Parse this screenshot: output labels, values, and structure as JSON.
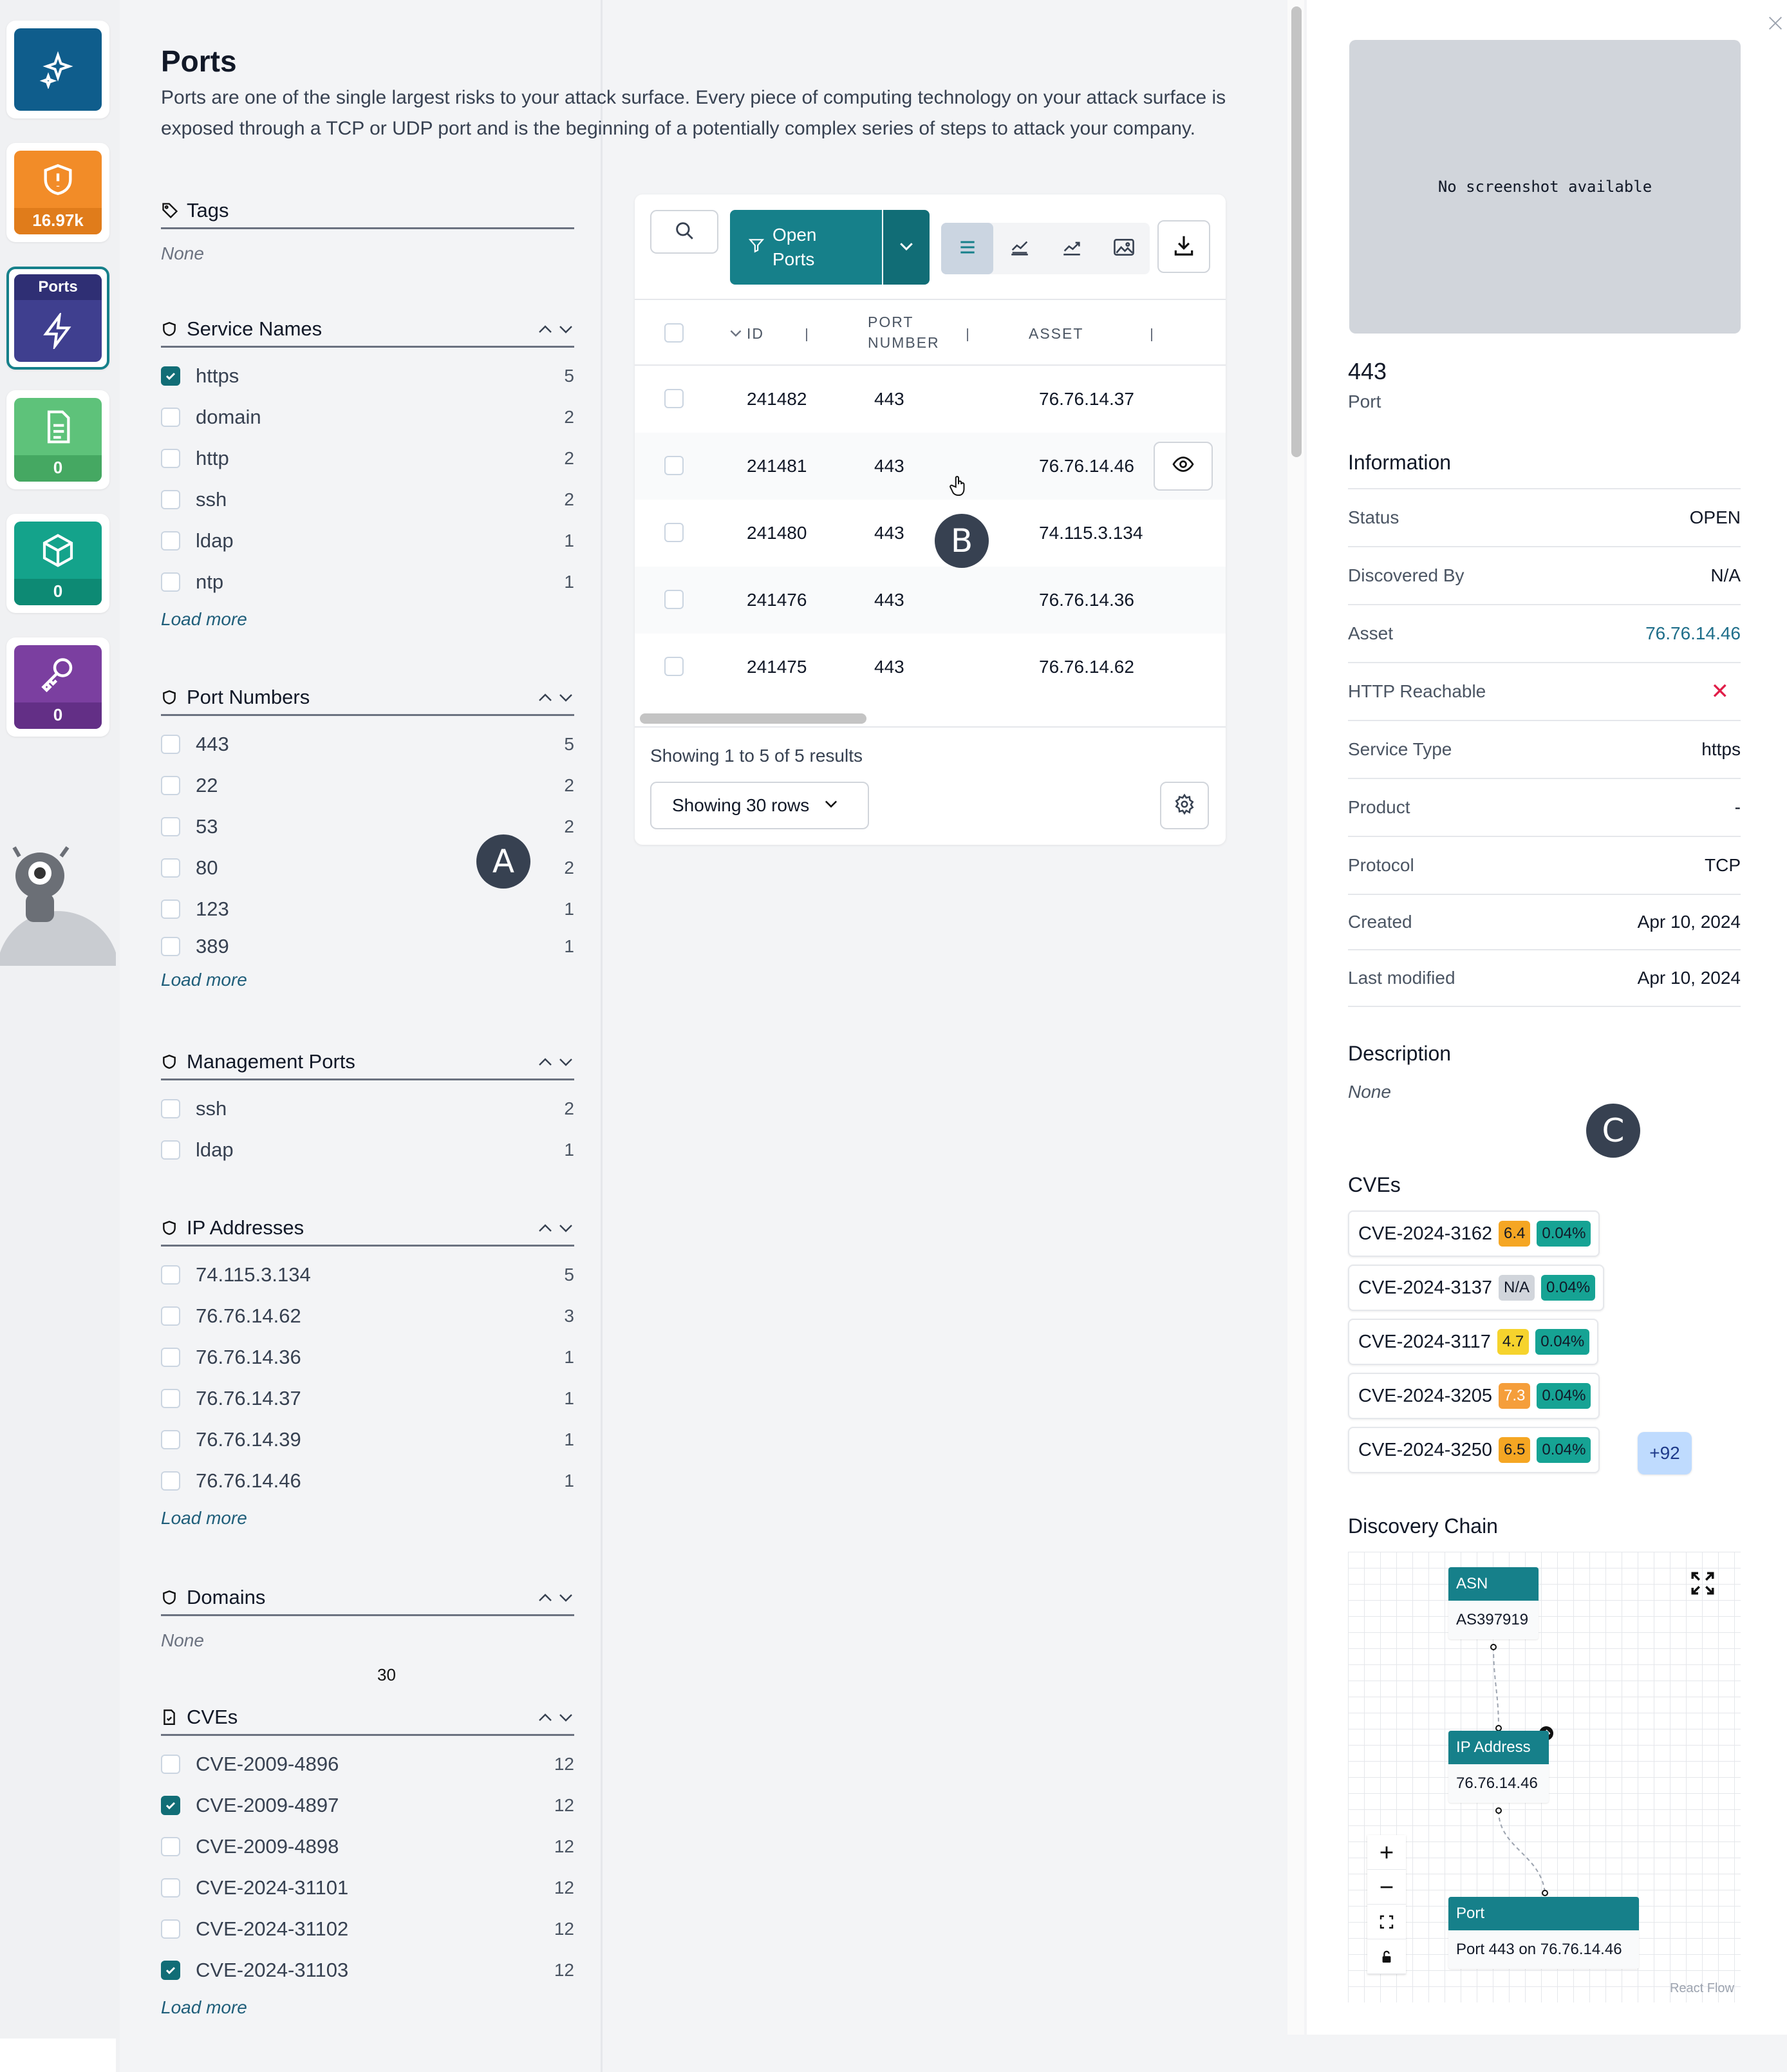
{
  "rail": {
    "items": [
      {
        "name": "ai-sparkle",
        "count": "",
        "color": "#0f5d8c"
      },
      {
        "name": "issues",
        "count": "16.97k",
        "color": "#f28c28"
      },
      {
        "name": "ports",
        "label": "Ports",
        "count": "",
        "color": "#3f3f8f"
      },
      {
        "name": "documents",
        "count": "0",
        "color": "#5ec27a"
      },
      {
        "name": "assets",
        "count": "0",
        "color": "#14a38b"
      },
      {
        "name": "credentials",
        "count": "0",
        "color": "#7b3fa0"
      }
    ]
  },
  "page": {
    "title": "Ports",
    "description": "Ports are one of the single largest risks to your attack surface. Every piece of computing technology on your attack surface is exposed through a TCP or UDP port and is the beginning of a potentially complex series of steps to attack your company."
  },
  "filters": {
    "tags": {
      "title": "Tags",
      "none": "None"
    },
    "service_names": {
      "title": "Service Names",
      "items": [
        {
          "label": "https",
          "count": "5",
          "checked": true
        },
        {
          "label": "domain",
          "count": "2",
          "checked": false
        },
        {
          "label": "http",
          "count": "2",
          "checked": false
        },
        {
          "label": "ssh",
          "count": "2",
          "checked": false
        },
        {
          "label": "ldap",
          "count": "1",
          "checked": false
        },
        {
          "label": "ntp",
          "count": "1",
          "checked": false
        }
      ],
      "load_more": "Load more"
    },
    "port_numbers": {
      "title": "Port Numbers",
      "items": [
        {
          "label": "443",
          "count": "5"
        },
        {
          "label": "22",
          "count": "2"
        },
        {
          "label": "53",
          "count": "2"
        },
        {
          "label": "80",
          "count": "2"
        },
        {
          "label": "123",
          "count": "1"
        },
        {
          "label": "389",
          "count": "1"
        }
      ],
      "load_more": "Load more"
    },
    "management_ports": {
      "title": "Management Ports",
      "items": [
        {
          "label": "ssh",
          "count": "2"
        },
        {
          "label": "ldap",
          "count": "1"
        }
      ]
    },
    "ip_addresses": {
      "title": "IP Addresses",
      "items": [
        {
          "label": "74.115.3.134",
          "count": "5"
        },
        {
          "label": "76.76.14.62",
          "count": "3"
        },
        {
          "label": "76.76.14.36",
          "count": "1"
        },
        {
          "label": "76.76.14.37",
          "count": "1"
        },
        {
          "label": "76.76.14.39",
          "count": "1"
        },
        {
          "label": "76.76.14.46",
          "count": "1"
        }
      ],
      "load_more": "Load more"
    },
    "domains": {
      "title": "Domains",
      "none": "None",
      "stray": "30"
    },
    "cves": {
      "title": "CVEs",
      "items": [
        {
          "label": "CVE-2009-4896",
          "count": "12",
          "checked": false
        },
        {
          "label": "CVE-2009-4897",
          "count": "12",
          "checked": true
        },
        {
          "label": "CVE-2009-4898",
          "count": "12",
          "checked": false
        },
        {
          "label": "CVE-2024-31101",
          "count": "12",
          "checked": false
        },
        {
          "label": "CVE-2024-31102",
          "count": "12",
          "checked": false
        },
        {
          "label": "CVE-2024-31103",
          "count": "12",
          "checked": true
        }
      ],
      "load_more": "Load more"
    }
  },
  "markers": {
    "a": "A",
    "b": "B",
    "c": "C"
  },
  "table": {
    "open_ports_label": "Open Ports",
    "headers": {
      "id": "ID",
      "port": "PORT NUMBER",
      "asset": "ASSET"
    },
    "rows": [
      {
        "id": "241482",
        "port": "443",
        "asset": "76.76.14.37"
      },
      {
        "id": "241481",
        "port": "443",
        "asset": "76.76.14.46"
      },
      {
        "id": "241480",
        "port": "443",
        "asset": "74.115.3.134"
      },
      {
        "id": "241476",
        "port": "443",
        "asset": "76.76.14.36"
      },
      {
        "id": "241475",
        "port": "443",
        "asset": "76.76.14.62"
      }
    ],
    "showing": "Showing 1 to 5 of 5 results",
    "rows_select": "Showing 30 rows"
  },
  "detail": {
    "screenshot_text": "No screenshot available",
    "title": "443",
    "subtitle": "Port",
    "info_heading": "Information",
    "info": [
      {
        "k": "Status",
        "v": "OPEN"
      },
      {
        "k": "Discovered By",
        "v": "N/A"
      },
      {
        "k": "Asset",
        "v": "76.76.14.46"
      },
      {
        "k": "HTTP Reachable",
        "v": "✕"
      },
      {
        "k": "Service Type",
        "v": "https"
      },
      {
        "k": "Product",
        "v": "-"
      },
      {
        "k": "Protocol",
        "v": "TCP"
      },
      {
        "k": "Created",
        "v": "Apr 10, 2024"
      },
      {
        "k": "Last modified",
        "v": "Apr 10, 2024"
      }
    ],
    "description_heading": "Description",
    "description": "None",
    "cves_heading": "CVEs",
    "cves": [
      {
        "id": "CVE-2024-3162",
        "score": "6.4",
        "score_color": "#f5a623",
        "epss": "0.04%"
      },
      {
        "id": "CVE-2024-3137",
        "score": "N/A",
        "score_color": "#d1d5db",
        "epss": "0.04%"
      },
      {
        "id": "CVE-2024-3117",
        "score": "4.7",
        "score_color": "#f6d32d",
        "epss": "0.04%"
      },
      {
        "id": "CVE-2024-3205",
        "score": "7.3",
        "score_color": "#f59e3b",
        "epss": "0.04%"
      },
      {
        "id": "CVE-2024-3250",
        "score": "6.5",
        "score_color": "#f5a623",
        "epss": "0.04%"
      }
    ],
    "cves_more": "+92",
    "chain_heading": "Discovery Chain",
    "chain": {
      "asn": {
        "head": "ASN",
        "body": "AS397919"
      },
      "ip": {
        "head": "IP Address",
        "body": "76.76.14.46"
      },
      "port": {
        "head": "Port",
        "body": "Port 443 on 76.76.14.46"
      },
      "attribution": "React Flow"
    }
  }
}
